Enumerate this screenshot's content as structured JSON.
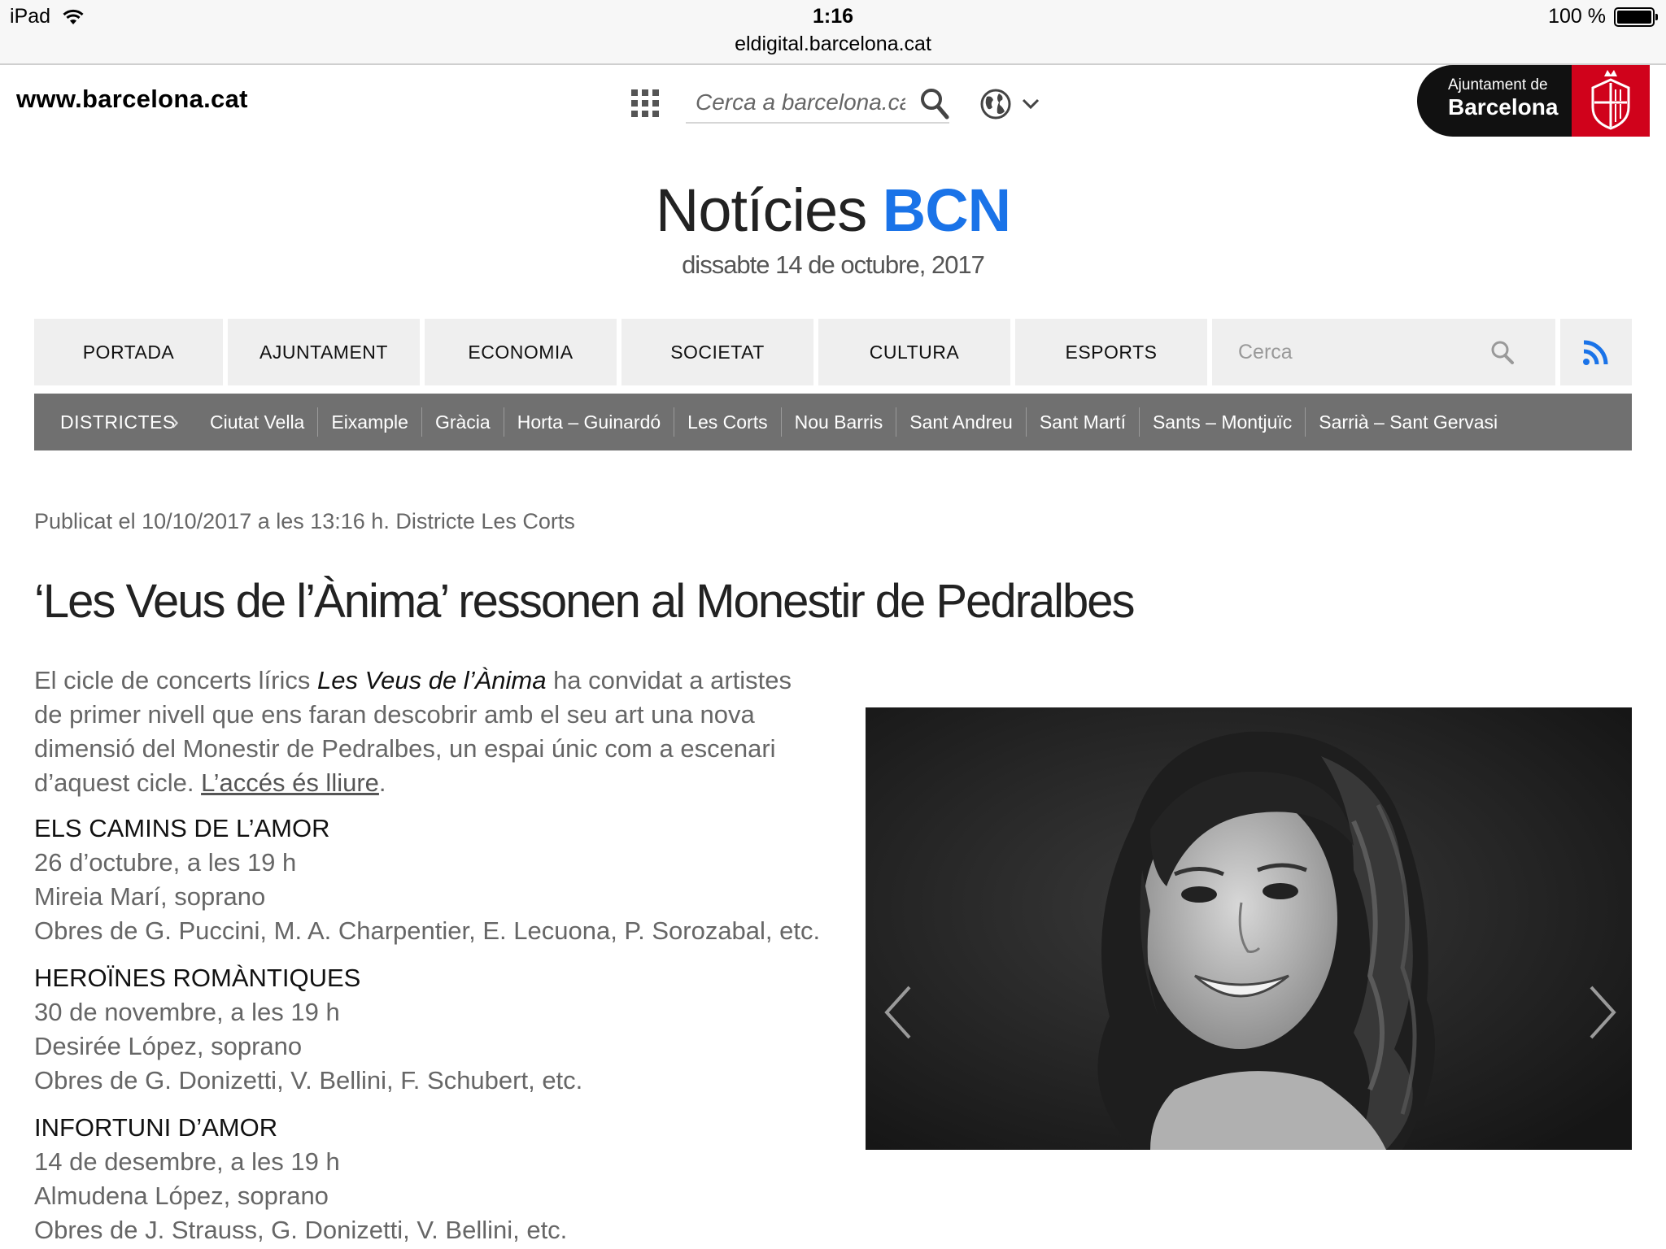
{
  "statusbar": {
    "device": "iPad",
    "time": "1:16",
    "url": "eldigital.barcelona.cat",
    "battery": "100 %"
  },
  "header": {
    "site_url": "www.barcelona.cat",
    "search_placeholder": "Cerca a barcelona.cat..",
    "logo_line1": "Ajuntament de",
    "logo_line2": "Barcelona"
  },
  "brand": {
    "part1": "Notícies ",
    "part2": "BCN",
    "date": "dissabte 14 de octubre, 2017",
    "accent_color": "#1a73e8"
  },
  "nav": {
    "items": [
      "PORTADA",
      "AJUNTAMENT",
      "ECONOMIA",
      "SOCIETAT",
      "CULTURA",
      "ESPORTS"
    ],
    "search_placeholder": "Cerca"
  },
  "districts": {
    "label": "DISTRICTES",
    "items": [
      "Ciutat Vella",
      "Eixample",
      "Gràcia",
      "Horta – Guinardó",
      "Les Corts",
      "Nou Barris",
      "Sant Andreu",
      "Sant Martí",
      "Sants – Montjuïc",
      "Sarrià – Sant Gervasi"
    ]
  },
  "article": {
    "published": "Publicat el 10/10/2017 a les 13:16 h. Districte Les Corts",
    "headline": "‘Les Veus de l’Ànima’ ressonen al Monestir de Pedralbes",
    "intro_before": "El cicle de concerts lírics ",
    "intro_em": "Les Veus de l’Ànima",
    "intro_after": " ha convidat a artistes de primer nivell que ens faran descobrir amb el seu art una nova dimensió del Monestir de Pedralbes, un espai únic com a escenari d’aquest cicle. ",
    "intro_link": "L’accés és lliure",
    "intro_end": ".",
    "concerts": [
      {
        "title": "ELS CAMINS DE L’AMOR",
        "date": "26 d’octubre, a les 19 h",
        "artist": "Mireia Marí, soprano",
        "works": "Obres de G. Puccini, M. A. Charpentier, E. Lecuona, P. Sorozabal, etc."
      },
      {
        "title": "HEROÏNES ROMÀNTIQUES",
        "date": "30 de novembre, a les 19 h",
        "artist": "Desirée López, soprano",
        "works": "Obres de G. Donizetti, V. Bellini, F. Schubert, etc."
      },
      {
        "title": "INFORTUNI D’AMOR",
        "date": "14 de desembre, a les 19 h",
        "artist": "Almudena López, soprano",
        "works": "Obres de J. Strauss, G. Donizetti, V. Bellini, etc."
      }
    ]
  }
}
